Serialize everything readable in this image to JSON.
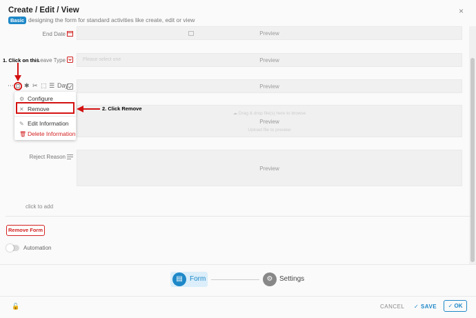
{
  "header": {
    "title": "Create / Edit / View",
    "badge": "Basic",
    "subtitle": "designing the form for standard activities like create, edit or view",
    "close_icon": "×"
  },
  "fields": [
    {
      "label": "End Date",
      "icon": "calendar-icon",
      "preview": "Preview"
    },
    {
      "label": "Leave Type",
      "icon": "select-icon",
      "placeholder": "Please select one",
      "preview": "Preview"
    },
    {
      "label": "Day",
      "icon": "checkbox-icon",
      "preview": "Preview"
    },
    {
      "label": "",
      "upload_hint": "Drag & drop file(s) here to browse",
      "preview": "Preview",
      "upload_sub": "Upload file to preview"
    },
    {
      "label": "Reject Reason",
      "icon": "lines-icon",
      "preview": "Preview"
    }
  ],
  "annotations": {
    "step1": "1. Click on this",
    "step2": "2. Click Remove"
  },
  "context_menu": {
    "items": [
      {
        "label": "Configure",
        "icon": "gear-icon"
      },
      {
        "label": "Remove",
        "icon": "close-icon"
      },
      {
        "label": "Edit Information",
        "icon": "edit-icon"
      },
      {
        "label": "Delete Information",
        "icon": "trash-icon",
        "danger": true
      }
    ]
  },
  "body": {
    "click_to_add": "click to add",
    "remove_form": "Remove Form",
    "automation_label": "Automation"
  },
  "tabs": {
    "form": "Form",
    "settings": "Settings"
  },
  "actions": {
    "cancel": "CANCEL",
    "save": "SAVE",
    "ok": "OK"
  },
  "colors": {
    "accent": "#1e88c8",
    "danger": "#d32020",
    "annotation_red": "#d41010"
  }
}
